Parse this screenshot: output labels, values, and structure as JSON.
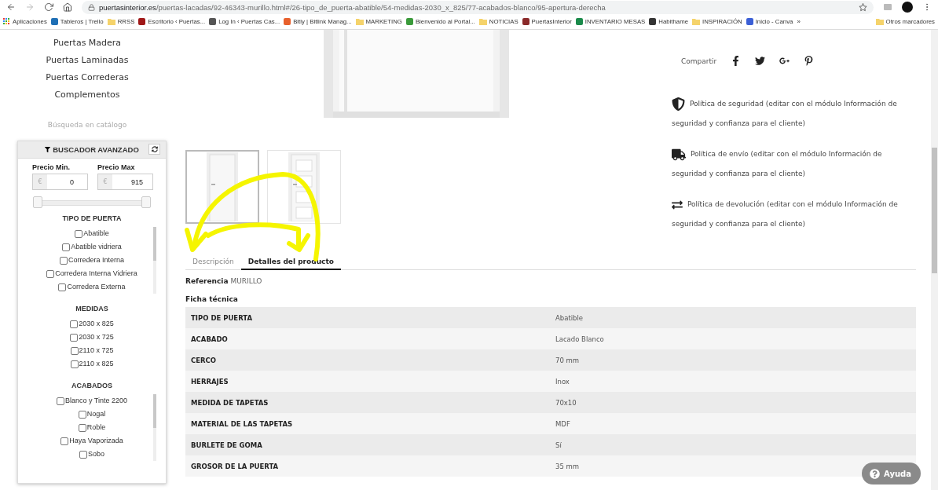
{
  "browser": {
    "url_host": "puertasinterior.es",
    "url_path": "/puertas-lacadas/92-46343-murillo.html#/26-tipo_de_puerta-abatible/54-medidas-2030_x_825/77-acabados-blanco/95-apertura-derecha",
    "bookmarks": [
      {
        "kind": "apps",
        "label": "Aplicaciones"
      },
      {
        "kind": "site",
        "label": "Tableros | Trello",
        "color": "#1f6fb5"
      },
      {
        "kind": "folder",
        "label": "RRSS"
      },
      {
        "kind": "site",
        "label": "Escritorio ‹ Puertas...",
        "color": "#a01818"
      },
      {
        "kind": "site",
        "label": "Log In ‹ Puertas Cas...",
        "color": "#555555"
      },
      {
        "kind": "site",
        "label": "Bitly | Bitlink Manag...",
        "color": "#e8602c"
      },
      {
        "kind": "folder",
        "label": "MARKETING"
      },
      {
        "kind": "site",
        "label": "Bienvenido al Portal...",
        "color": "#3a9a3a"
      },
      {
        "kind": "folder",
        "label": "NOTICIAS"
      },
      {
        "kind": "site",
        "label": "PuertasInterior",
        "color": "#8a2a2a"
      },
      {
        "kind": "site",
        "label": "INVENTARIO MESAS",
        "color": "#1a8a4a"
      },
      {
        "kind": "site",
        "label": "Habithame",
        "color": "#333333"
      },
      {
        "kind": "folder",
        "label": "INSPIRACIÓN"
      },
      {
        "kind": "site",
        "label": "Inicio - Canva",
        "color": "#3b5fd6"
      },
      {
        "kind": "more",
        "label": "»"
      },
      {
        "kind": "folder",
        "label": "Otros marcadores"
      }
    ]
  },
  "nav": [
    "Puertas Madera",
    "Puertas Laminadas",
    "Puertas Correderas",
    "Complementos"
  ],
  "catalog_search": "Búsqueda en catálogo",
  "filter": {
    "title": "BUSCADOR AVANZADO",
    "price_min": {
      "label": "Precio Min.",
      "currency": "€",
      "value": "0"
    },
    "price_max": {
      "label": "Precio Max",
      "currency": "€",
      "value": "915"
    },
    "slider_thumbs": [
      {
        "level": 0
      },
      {
        "level": 1
      }
    ],
    "groups": [
      {
        "title": "TIPO DE PUERTA",
        "scroll": true,
        "options": [
          {
            "label": "Abatible",
            "checked": false
          },
          {
            "label": "Abatible vidriera",
            "checked": false
          },
          {
            "label": "Corredera Interna",
            "checked": false
          },
          {
            "label": "Corredera Interna Vidriera",
            "checked": false
          },
          {
            "label": "Corredera Externa",
            "checked": false
          }
        ]
      },
      {
        "title": "MEDIDAS",
        "scroll": false,
        "options": [
          {
            "label": "2030 x 825",
            "checked": false
          },
          {
            "label": "2030 x 725",
            "checked": false
          },
          {
            "label": "2110 x 725",
            "checked": false
          },
          {
            "label": "2110 x 825",
            "checked": false
          }
        ]
      },
      {
        "title": "ACABADOS",
        "scroll": true,
        "options": [
          {
            "label": "Blanco y Tinte 2200",
            "checked": false
          },
          {
            "label": "Nogal",
            "checked": false
          },
          {
            "label": "Roble",
            "checked": false
          },
          {
            "label": "Haya Vaporizada",
            "checked": false
          },
          {
            "label": "Sobo",
            "checked": false
          }
        ]
      }
    ]
  },
  "thumbnails": [
    {
      "kind": "plain",
      "selected": true
    },
    {
      "kind": "panels",
      "selected": false
    }
  ],
  "share": {
    "label": "Compartir"
  },
  "policies": [
    {
      "kind": "security",
      "text": "Política de seguridad (editar con el módulo Información de seguridad y confianza para el cliente)"
    },
    {
      "kind": "shipping",
      "text": "Política de envío (editar con el módulo Información de seguridad y confianza para el cliente)"
    },
    {
      "kind": "returns",
      "text": "Política de devolución (editar con el módulo Información de seguridad y confianza para el cliente)"
    }
  ],
  "tabs": [
    {
      "label": "Descripción",
      "selected": false
    },
    {
      "label": "Detalles del producto",
      "selected": true
    }
  ],
  "reference": {
    "label": "Referencia",
    "value": "MURILLO"
  },
  "sheet_title": "Ficha técnica",
  "specs": [
    {
      "name": "TIPO DE PUERTA",
      "value": "Abatible"
    },
    {
      "name": "ACABADO",
      "value": "Lacado Blanco"
    },
    {
      "name": "CERCO",
      "value": "70 mm"
    },
    {
      "name": "HERRAJES",
      "value": "Inox"
    },
    {
      "name": "MEDIDA DE TAPETAS",
      "value": "70x10"
    },
    {
      "name": "MATERIAL DE LAS TAPETAS",
      "value": "MDF"
    },
    {
      "name": "BURLETE DE GOMA",
      "value": "Sí"
    },
    {
      "name": "GROSOR DE LA PUERTA",
      "value": "35 mm"
    }
  ],
  "help_button": "Ayuda"
}
